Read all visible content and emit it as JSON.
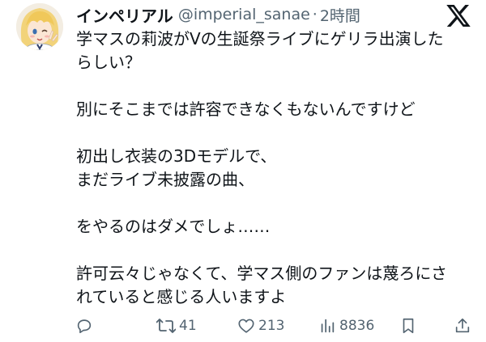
{
  "tweet": {
    "display_name": "インペリアル",
    "handle": "@imperial_sanae",
    "separator": "·",
    "time": "2時間",
    "avatar_icon": "anime-girl-avatar-icon",
    "brand_icon": "x-logo-icon",
    "lines": [
      "学マスの莉波がVの生誕祭ライブにゲリラ出演した",
      "らしい？",
      "",
      "別にそこまでは許容できなくもないんですけど",
      "",
      "初出し衣装の3Dモデルで、",
      "まだライブ未披露の曲、",
      "",
      "をやるのはダメでしょ……",
      "",
      "許可云々じゃなくて、学マス側のファンは蔑ろにさ",
      "れていると感じる人いますよ"
    ]
  },
  "actions": {
    "reply": {
      "icon": "reply-icon",
      "count": ""
    },
    "retweet": {
      "icon": "retweet-icon",
      "count": "41"
    },
    "like": {
      "icon": "heart-icon",
      "count": "213"
    },
    "views": {
      "icon": "views-chart-icon",
      "count": "8836"
    },
    "bookmark": {
      "icon": "bookmark-icon",
      "count": ""
    },
    "share": {
      "icon": "share-icon",
      "count": ""
    }
  },
  "colors": {
    "text": "#0f1419",
    "secondary": "#536471",
    "background": "#ffffff"
  }
}
